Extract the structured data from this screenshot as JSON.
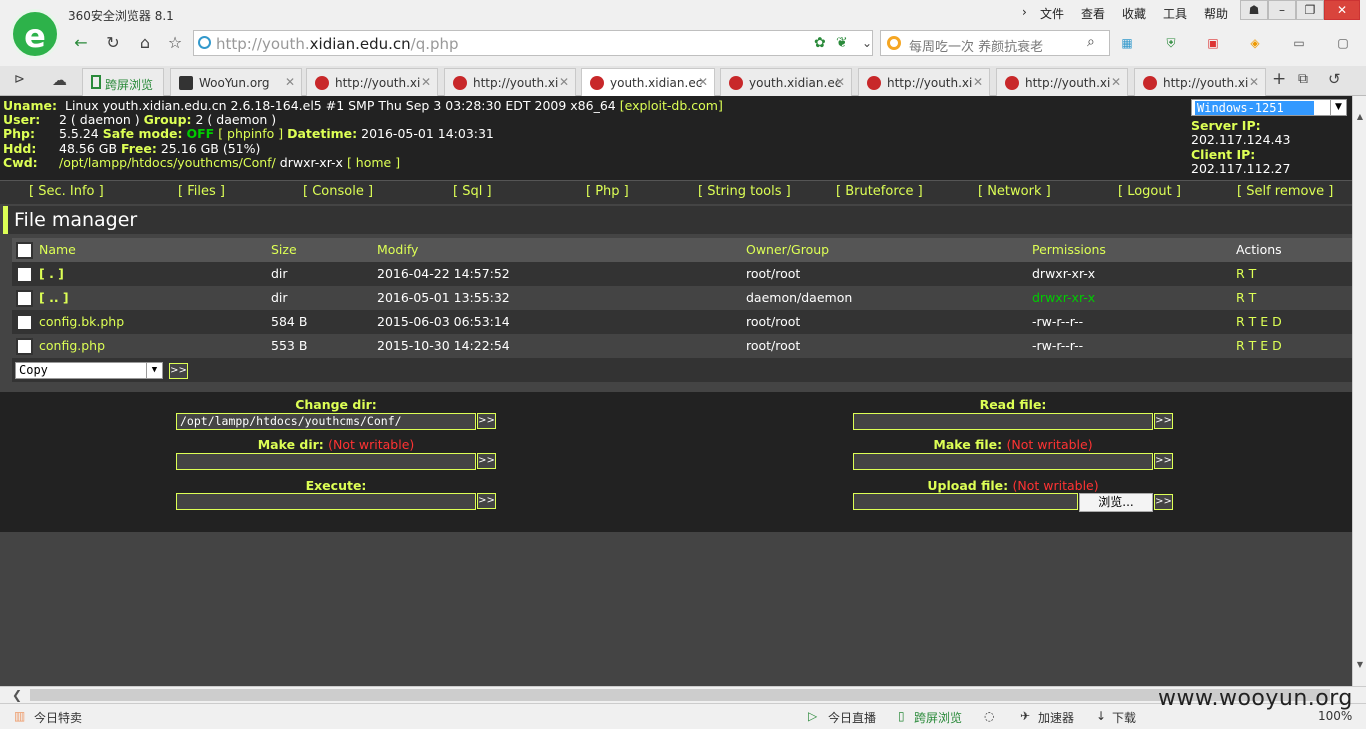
{
  "browser": {
    "app_title": "360安全浏览器 8.1",
    "menu": [
      "文件",
      "查看",
      "收藏",
      "工具",
      "帮助"
    ],
    "url_prefix": "http://youth.",
    "url_host": "xidian.edu.cn",
    "url_path": "/q.php",
    "search_placeholder": "每周吃一次 养颜抗衰老",
    "tabs": [
      {
        "title": "跨屏浏览"
      },
      {
        "title": "WooYun.org"
      },
      {
        "title": "http://youth.xi"
      },
      {
        "title": "http://youth.xi"
      },
      {
        "title": "youth.xidian.ec"
      },
      {
        "title": "youth.xidian.ec"
      },
      {
        "title": "http://youth.xi"
      },
      {
        "title": "http://youth.xi"
      },
      {
        "title": "http://youth.xi"
      }
    ],
    "zoom": "100%"
  },
  "sysinfo": {
    "uname_label": "Uname:",
    "uname": "Linux youth.xidian.edu.cn 2.6.18-164.el5 #1 SMP Thu Sep 3 03:28:30 EDT 2009 x86_64",
    "exploit_link": "[exploit-db.com]",
    "user_label": "User:",
    "user": "2 ( daemon )",
    "group_label": "Group:",
    "group": "2 ( daemon )",
    "php_label": "Php:",
    "php": "5.5.24",
    "safe_mode_label": "Safe mode:",
    "safe_mode": "OFF",
    "phpinfo_link": "[ phpinfo ]",
    "datetime_label": "Datetime:",
    "datetime": "2016-05-01 14:03:31",
    "hdd_label": "Hdd:",
    "hdd": "48.56 GB",
    "free_label": "Free:",
    "free": "25.16 GB (51%)",
    "cwd_label": "Cwd:",
    "cwd": "/opt/lampp/htdocs/youthcms/Conf/",
    "cwd_perm": "drwxr-xr-x",
    "home_link": "[ home ]",
    "encoding": "Windows-1251",
    "server_ip_label": "Server IP:",
    "server_ip": "202.117.124.43",
    "client_ip_label": "Client IP:",
    "client_ip": "202.117.112.27"
  },
  "nav": [
    "[ Sec. Info ]",
    "[ Files ]",
    "[ Console ]",
    "[ Sql ]",
    "[ Php ]",
    "[ String tools ]",
    "[ Bruteforce ]",
    "[ Network ]",
    "[ Logout ]",
    "[ Self remove ]"
  ],
  "file_manager": {
    "title": "File manager",
    "columns": [
      "Name",
      "Size",
      "Modify",
      "Owner/Group",
      "Permissions",
      "Actions"
    ],
    "rows": [
      {
        "name": "[ . ]",
        "size": "dir",
        "modify": "2016-04-22 14:57:52",
        "owner": "root/root",
        "perms": "drwxr-xr-x",
        "actions": "R T"
      },
      {
        "name": "[ .. ]",
        "size": "dir",
        "modify": "2016-05-01 13:55:32",
        "owner": "daemon/daemon",
        "perms": "drwxr-xr-x",
        "actions": "R T"
      },
      {
        "name": "config.bk.php",
        "size": "584 B",
        "modify": "2015-06-03 06:53:14",
        "owner": "root/root",
        "perms": "-rw-r--r--",
        "actions": "R T E D"
      },
      {
        "name": "config.php",
        "size": "553 B",
        "modify": "2015-10-30 14:22:54",
        "owner": "root/root",
        "perms": "-rw-r--r--",
        "actions": "R T E D"
      }
    ],
    "bulk_action": "Copy",
    "go": ">>"
  },
  "forms": {
    "change_dir": "Change dir:",
    "change_dir_value": "/opt/lampp/htdocs/youthcms/Conf/",
    "read_file": "Read file:",
    "make_dir": "Make dir:",
    "make_file": "Make file:",
    "not_writable": "(Not writable)",
    "execute": "Execute:",
    "upload_file": "Upload file:",
    "browse": "浏览...",
    "go": ">>"
  },
  "statusbar": {
    "left": "今日特卖",
    "live": "今日直播",
    "cross": "跨屏浏览",
    "accel": "加速器",
    "download": "下载",
    "zoom": "100%"
  },
  "watermark": "www.wooyun.org"
}
